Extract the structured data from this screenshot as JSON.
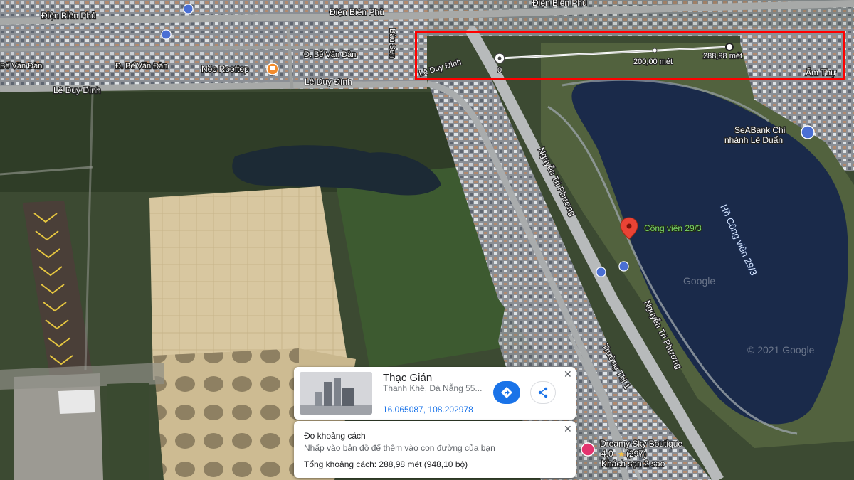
{
  "map": {
    "streets": {
      "dien_bien_phu_1": "Điện Biên Phủ",
      "dien_bien_phu_2": "Điện Biên Phủ",
      "dien_bien_phu_3": "Điện Biên Phủ",
      "be_van_dan_1": "Bế Văn Đàn",
      "be_van_dan_2": "Đ. Bế Văn Đàn",
      "be_van_dan_3": "Đ. Bế Văn Đàn",
      "le_duy_dinh_1": "Lê Duy Đình",
      "le_duy_dinh_2": "Lê Duy Đình",
      "le_duy_dinh_3": "Lê Duy Đình",
      "bau_sen": "Bàu Sen",
      "nguyen_tri_phuong_1": "Nguyễn Tri Phương",
      "nguyen_tri_phuong_2": "Nguyễn Tri Phương",
      "truong_thi": "Trường Thi 1"
    },
    "places": {
      "noc_rooftop": "Nóc Rooftop",
      "cong_vien": "Công viên 29/3",
      "ho_cong_vien": "Hồ Công viên 29/3",
      "seabank_line1": "SeABank Chi",
      "seabank_line2": "nhánh Lê Duẩn",
      "am_thuc": "Ẩm Thự",
      "dreamy_sky": "Dreamy Sky Boutique",
      "dreamy_rating": "4,0",
      "dreamy_reviews": "(297)",
      "dreamy_type": "Khách sạn 2 sao"
    },
    "watermarks": {
      "google": "Google",
      "copyright": "© 2021 Google"
    },
    "measure_line": {
      "start_label": "0",
      "mid_label": "200,00 mét",
      "end_label": "288,98 mét"
    }
  },
  "info_card": {
    "title": "Thạc Gián",
    "subtitle": "Thanh Khê, Đà Nẵng 55...",
    "coordinates": "16.065087, 108.202978",
    "close": "✕",
    "directions_icon": "directions-icon",
    "share_icon": "share-icon"
  },
  "measure_panel": {
    "title": "Đo khoảng cách",
    "hint": "Nhấp vào bản đồ để thêm vào con đường của bạn",
    "total": "Tổng khoảng cách: 288,98 mét (948,10 bộ)",
    "close": "✕"
  },
  "colors": {
    "highlight": "#ff0000",
    "accent_blue": "#1a73e8",
    "pin_red": "#ea4335",
    "poi_orange": "#f28b2c"
  }
}
